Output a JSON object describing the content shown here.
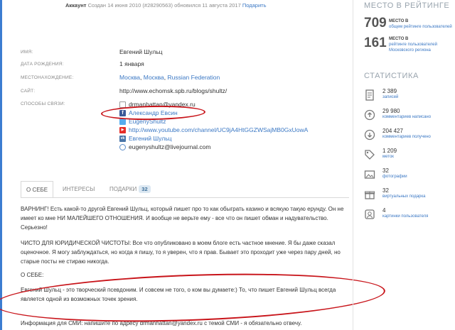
{
  "account": {
    "label": "Аккаунт",
    "created": "Создан 14 июня 2010 (#28290563)",
    "updated": "обновился 11 августа 2017",
    "subscribe": "Подарить"
  },
  "profile": {
    "name": {
      "label": "ИМЯ:",
      "value": "Евгений Шульц"
    },
    "birthday": {
      "label": "ДАТА РОЖДЕНИЯ:",
      "value": "1 января"
    },
    "location": {
      "label": "МЕСТОНАХОЖДЕНИЕ:",
      "city": "Москва",
      "region": "Москва",
      "country": "Russian Federation"
    },
    "site": {
      "label": "САЙТ:",
      "value": "http://www.echomsk.spb.ru/blogs/shultz/"
    },
    "contacts": {
      "label": "СПОСОБЫ СВЯЗИ:",
      "email": "drmanhattan@yandex.ru",
      "facebook": "Александр Евсин",
      "twitter": "EugenyShultz",
      "youtube": "http://www.youtube.com/channel/UC9jA4HtGGZWSajMB0GxUowA",
      "vk": "Евгений Шульц",
      "lj": "eugenyshultz@livejournal.com"
    }
  },
  "tabs": [
    {
      "label": "О СЕБЕ"
    },
    {
      "label": "ИНТЕРЕСЫ"
    },
    {
      "label": "ПОДАРКИ",
      "badge": "32"
    }
  ],
  "bio": {
    "p1": "ВАРНИНГ! Есть какой-то другой Евгений Шульц, который пишет про то как обыграть казино и всякую такую ерунду. Он не имеет ко мне НИ МАЛЕЙШЕГО ОТНОШЕНИЯ. И вообще не верьте ему - все что он пишет обман и надувательство. Серьезно!",
    "p2": "ЧИСТО ДЛЯ ЮРИДИЧЕСКОЙ ЧИСТОТЫ: Все что опубликовано в моем блоге есть частное мнение. Я бы даже сказал оценочное. Я могу заблуждаться, но когда я пишу, то я уверен, что я прав. Бывает это проходит уже через пару дней, но старые посты не стираю никогда.",
    "p3": "О СЕБЕ:",
    "p4": "Евгений Шульц - это творческий псевдоним. И совсем не того, о ком вы думаете:) То, что пишет Евгений Шульц всегда является одной из возможных точек зрения.",
    "p5": "Информация для СМИ: напишите по адресу drmanhattan@yandex.ru с темой СМИ - я обязательно отвечу."
  },
  "sidebar": {
    "rating_title": "МЕСТО В РЕЙТИНГЕ",
    "ranks": [
      {
        "num": "709",
        "title": "МЕСТО В",
        "link": "общем рейтинге пользователей"
      },
      {
        "num": "161",
        "title": "МЕСТО В",
        "link": "рейтинге пользователей Московского региона"
      }
    ],
    "stats_title": "СТАТИСТИКА",
    "stats": [
      {
        "icon": "posts-icon",
        "value": "2 389",
        "label": "записей"
      },
      {
        "icon": "comments-written-icon",
        "value": "29 980",
        "label": "комментариев написано"
      },
      {
        "icon": "comments-received-icon",
        "value": "204 427",
        "label": "комментариев получено"
      },
      {
        "icon": "tags-icon",
        "value": "1 209",
        "label": "меток"
      },
      {
        "icon": "photos-icon",
        "value": "32",
        "label": "фотографии"
      },
      {
        "icon": "gifts-icon",
        "value": "32",
        "label": "виртуальных подарка"
      },
      {
        "icon": "userpics-icon",
        "value": "4",
        "label": "картинки пользователя"
      }
    ]
  },
  "colors": {
    "accent": "#3b78c4",
    "annotation": "#c8141a",
    "facebook": "#3b5998",
    "twitter": "#55acee",
    "youtube": "#e52d27",
    "vk": "#4a76a8"
  }
}
